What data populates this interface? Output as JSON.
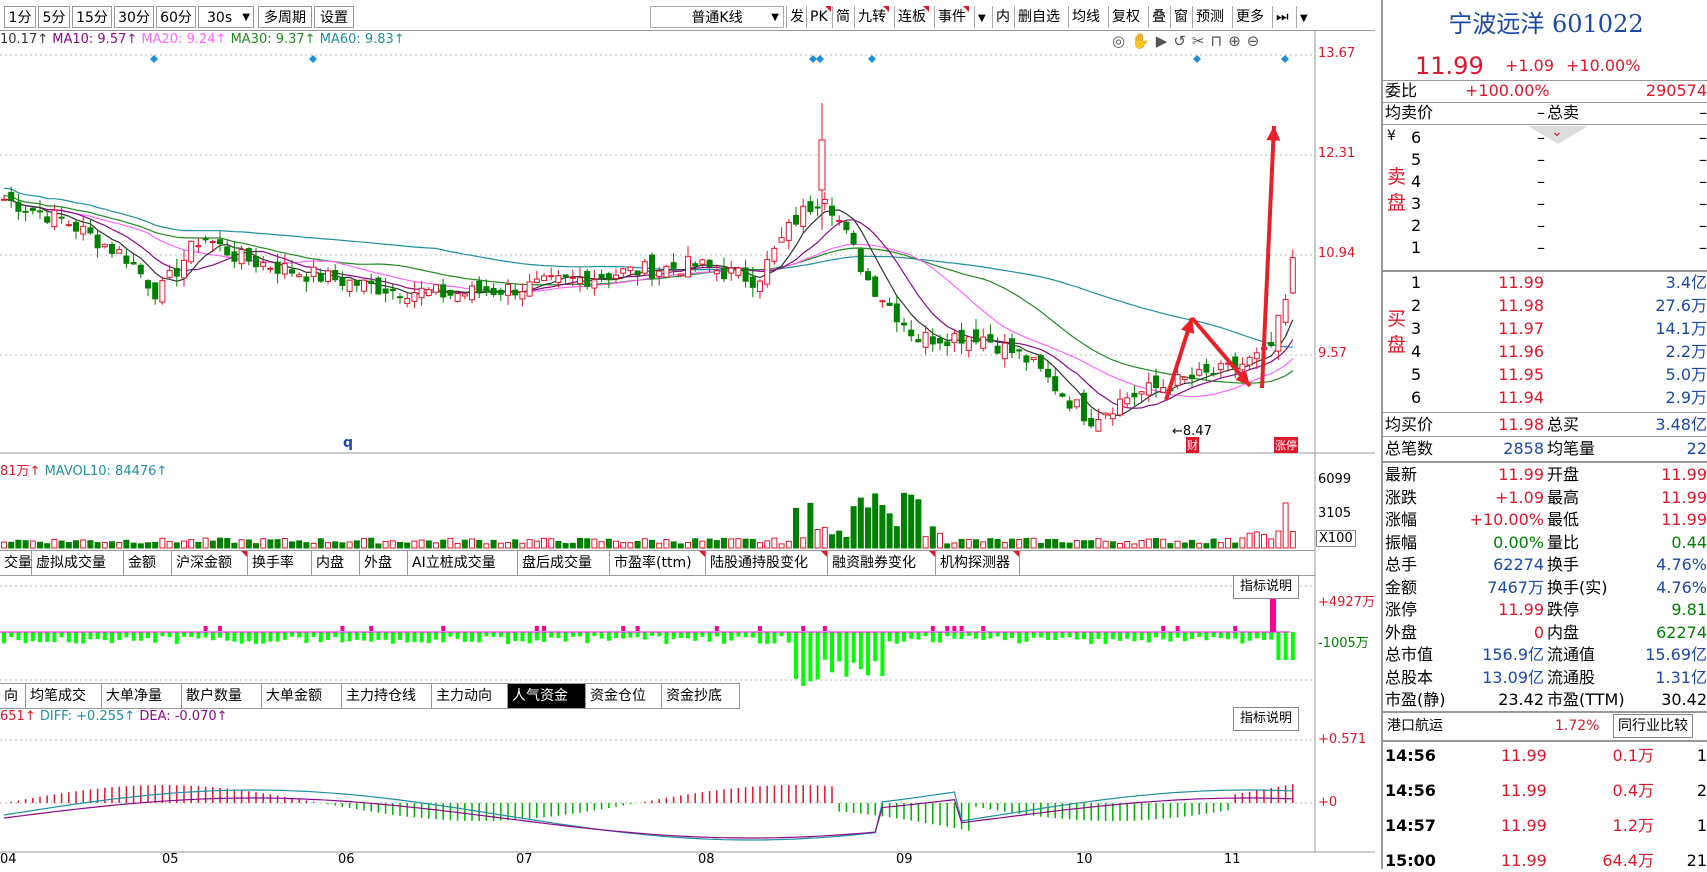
{
  "toolbar": {
    "periods": [
      "1分",
      "5分",
      "15分",
      "30分",
      "60分",
      "30s"
    ],
    "multi_period": "多周期",
    "settings": "设置",
    "kline_type": "普通K线",
    "tools": [
      "发",
      "PK",
      "简",
      "九转",
      "连板",
      "事件",
      "内",
      "删自选",
      "均线",
      "复权",
      "叠",
      "窗",
      "预测",
      "更多"
    ]
  },
  "legend_ma": {
    "ma5": "10.17↑",
    "ma10": "MA10: 9.57↑",
    "ma20": "MA20: 9.24↑",
    "ma30": "MA30: 9.37↑",
    "ma60": "MA60: 9.83↑"
  },
  "legend_vol": {
    "vol": "81万↑",
    "mavol": "MAVOL10: 84476↑"
  },
  "legend_macd": {
    "macd": "651↑",
    "diff": "DIFF: +0.255↑",
    "dea": "DEA: -0.070↑"
  },
  "price_axis": [
    "13.67",
    "12.31",
    "10.94",
    "9.57"
  ],
  "vol_axis": [
    "6099",
    "3105",
    "X100"
  ],
  "flow_axis": [
    "+4927万",
    "-1005万"
  ],
  "macd_axis": [
    "+0.571",
    "+0"
  ],
  "date_axis": [
    "04",
    "05",
    "06",
    "07",
    "08",
    "09",
    "10",
    "11"
  ],
  "low_label": "8.47",
  "cursor_q": "q",
  "tag_cai": "财",
  "tag_zt": "涨停",
  "tabs1": [
    "交量",
    "虚拟成交量",
    "金额",
    "沪深金额",
    "换手率",
    "内盘",
    "外盘",
    "AI立桩成交量",
    "盘后成交量",
    "市盈率(ttm)",
    "陆股通持股变化",
    "融资融券变化",
    "机构探测器"
  ],
  "tabs2": [
    "向",
    "均笔成交",
    "大单净量",
    "散户数量",
    "大单金额",
    "主力持仓线",
    "主力动向",
    "人气资金",
    "资金仓位",
    "资金抄底"
  ],
  "explain_label": "指标说明",
  "stock": {
    "name": "宁波远洋",
    "code": "601022",
    "price": "11.99",
    "change": "+1.09",
    "change_pct": "+10.00%",
    "weibi_label": "委比",
    "weibi": "+100.00%",
    "weicha": "290574",
    "avg_sell_label": "均卖价",
    "avg_sell": "–",
    "total_sell_label": "总卖",
    "total_sell": "–",
    "sell_side_label": "卖盘",
    "buy_side_label": "买盘",
    "yen": "¥",
    "sell": [
      {
        "lv": "6",
        "p": "–",
        "v": "–"
      },
      {
        "lv": "5",
        "p": "–",
        "v": "–"
      },
      {
        "lv": "4",
        "p": "–",
        "v": "–"
      },
      {
        "lv": "3",
        "p": "–",
        "v": "–"
      },
      {
        "lv": "2",
        "p": "–",
        "v": "–"
      },
      {
        "lv": "1",
        "p": "–",
        "v": "–"
      }
    ],
    "buy": [
      {
        "lv": "1",
        "p": "11.99",
        "v": "3.4亿"
      },
      {
        "lv": "2",
        "p": "11.98",
        "v": "27.6万"
      },
      {
        "lv": "3",
        "p": "11.97",
        "v": "14.1万"
      },
      {
        "lv": "4",
        "p": "11.96",
        "v": "2.2万"
      },
      {
        "lv": "5",
        "p": "11.95",
        "v": "5.0万"
      },
      {
        "lv": "6",
        "p": "11.94",
        "v": "2.9万"
      }
    ],
    "avg_buy_label": "均买价",
    "avg_buy": "11.98",
    "total_buy_label": "总买",
    "total_buy": "3.48亿",
    "total_trades_label": "总笔数",
    "total_trades": "2858",
    "avg_trade_label": "均笔量",
    "avg_trade": "22",
    "stats": [
      {
        "l1": "最新",
        "v1": "11.99",
        "c1": "red",
        "l2": "开盘",
        "v2": "11.99",
        "c2": "red"
      },
      {
        "l1": "涨跌",
        "v1": "+1.09",
        "c1": "red",
        "l2": "最高",
        "v2": "11.99",
        "c2": "red"
      },
      {
        "l1": "涨幅",
        "v1": "+10.00%",
        "c1": "red",
        "l2": "最低",
        "v2": "11.99",
        "c2": "red"
      },
      {
        "l1": "振幅",
        "v1": "0.00%",
        "c1": "green",
        "l2": "量比",
        "v2": "0.44",
        "c2": "green"
      },
      {
        "l1": "总手",
        "v1": "62274",
        "c1": "blue",
        "l2": "换手",
        "v2": "4.76%",
        "c2": "blue"
      },
      {
        "l1": "金额",
        "v1": "7467万",
        "c1": "blue",
        "l2": "换手(实)",
        "v2": "4.76%",
        "c2": "blue"
      },
      {
        "l1": "涨停",
        "v1": "11.99",
        "c1": "red",
        "l2": "跌停",
        "v2": "9.81",
        "c2": "green"
      },
      {
        "l1": "外盘",
        "v1": "0",
        "c1": "red",
        "l2": "内盘",
        "v2": "62274",
        "c2": "green"
      },
      {
        "l1": "总市值",
        "v1": "156.9亿",
        "c1": "blue",
        "l2": "流通值",
        "v2": "15.69亿",
        "c2": "blue"
      },
      {
        "l1": "总股本",
        "v1": "13.09亿",
        "c1": "blue",
        "l2": "流通股",
        "v2": "1.31亿",
        "c2": "blue"
      },
      {
        "l1": "市盈(静)",
        "v1": "23.42",
        "c1": "black",
        "l2": "市盈(TTM)",
        "v2": "30.42",
        "c2": "black"
      }
    ],
    "sector": "港口航运",
    "sector_pct": "1.72%",
    "compare_btn": "同行业比较",
    "ticks": [
      {
        "t": "14:56",
        "p": "11.99",
        "v": "0.1万",
        "n": "1"
      },
      {
        "t": "14:56",
        "p": "11.99",
        "v": "0.4万",
        "n": "2"
      },
      {
        "t": "14:57",
        "p": "11.99",
        "v": "1.2万",
        "n": "1"
      },
      {
        "t": "15:00",
        "p": "11.99",
        "v": "64.4万",
        "n": "21"
      }
    ]
  },
  "colors": {
    "up": "#e0162b",
    "down": "#008000",
    "ma5": "#333333",
    "ma10": "#8b0a8b",
    "ma20": "#ff66ff",
    "ma30": "#228b22",
    "ma60": "#2090a0",
    "axis_text": "#e0162b"
  }
}
